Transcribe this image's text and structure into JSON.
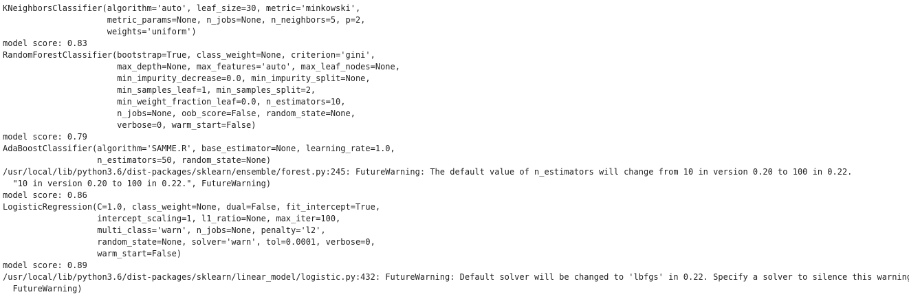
{
  "cell_output": {
    "lines": [
      "KNeighborsClassifier(algorithm='auto', leaf_size=30, metric='minkowski',",
      "                     metric_params=None, n_jobs=None, n_neighbors=5, p=2,",
      "                     weights='uniform')",
      "model score: 0.83",
      "RandomForestClassifier(bootstrap=True, class_weight=None, criterion='gini',",
      "                       max_depth=None, max_features='auto', max_leaf_nodes=None,",
      "                       min_impurity_decrease=0.0, min_impurity_split=None,",
      "                       min_samples_leaf=1, min_samples_split=2,",
      "                       min_weight_fraction_leaf=0.0, n_estimators=10,",
      "                       n_jobs=None, oob_score=False, random_state=None,",
      "                       verbose=0, warm_start=False)",
      "model score: 0.79",
      "AdaBoostClassifier(algorithm='SAMME.R', base_estimator=None, learning_rate=1.0,",
      "                   n_estimators=50, random_state=None)",
      "/usr/local/lib/python3.6/dist-packages/sklearn/ensemble/forest.py:245: FutureWarning: The default value of n_estimators will change from 10 in version 0.20 to 100 in 0.22.",
      "  \"10 in version 0.20 to 100 in 0.22.\", FutureWarning)",
      "model score: 0.86",
      "LogisticRegression(C=1.0, class_weight=None, dual=False, fit_intercept=True,",
      "                   intercept_scaling=1, l1_ratio=None, max_iter=100,",
      "                   multi_class='warn', n_jobs=None, penalty='l2',",
      "                   random_state=None, solver='warn', tol=0.0001, verbose=0,",
      "                   warm_start=False)",
      "model score: 0.89",
      "/usr/local/lib/python3.6/dist-packages/sklearn/linear_model/logistic.py:432: FutureWarning: Default solver will be changed to 'lbfgs' in 0.22. Specify a solver to silence this warning.",
      "  FutureWarning)"
    ]
  }
}
